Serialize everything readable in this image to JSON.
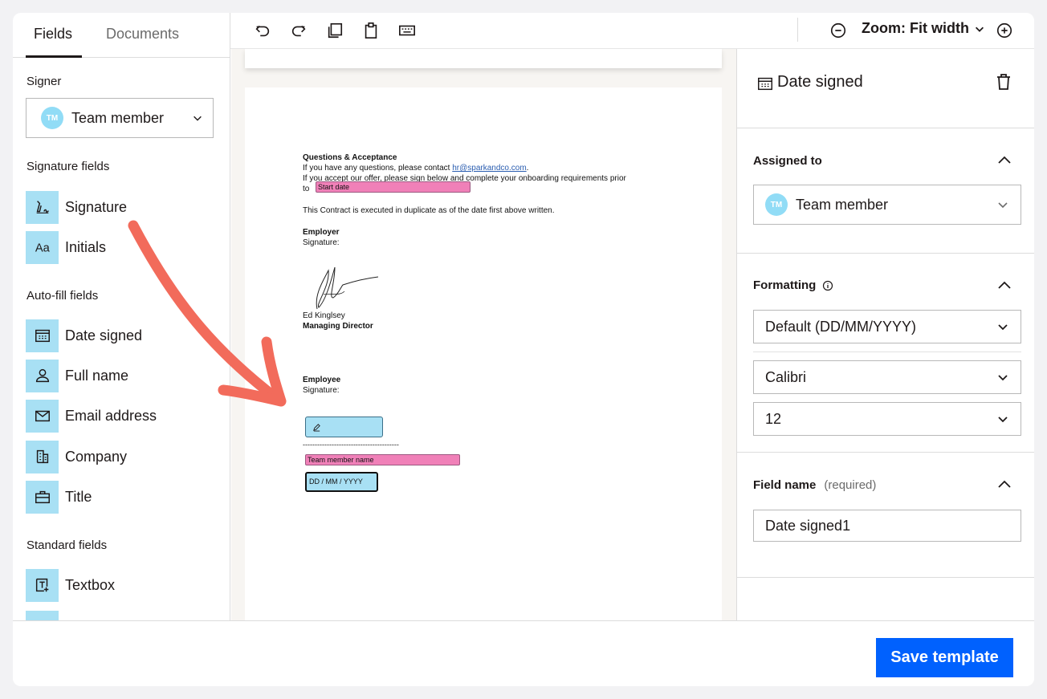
{
  "tabs": {
    "fields": "Fields",
    "documents": "Documents"
  },
  "left": {
    "signer_label": "Signer",
    "signer": {
      "initials": "TM",
      "name": "Team member"
    },
    "signature_fields_label": "Signature fields",
    "signature_fields": [
      {
        "label": "Signature",
        "icon": "signature-icon"
      },
      {
        "label": "Initials",
        "icon": "initials-icon"
      }
    ],
    "autofill_label": "Auto-fill fields",
    "autofill_fields": [
      {
        "label": "Date signed",
        "icon": "calendar-icon"
      },
      {
        "label": "Full name",
        "icon": "person-icon"
      },
      {
        "label": "Email address",
        "icon": "envelope-icon"
      },
      {
        "label": "Company",
        "icon": "building-icon"
      },
      {
        "label": "Title",
        "icon": "briefcase-icon"
      }
    ],
    "standard_label": "Standard fields",
    "standard_fields": [
      {
        "label": "Textbox",
        "icon": "textbox-icon"
      }
    ]
  },
  "toolbar": {
    "zoom_label": "Zoom: Fit width"
  },
  "document": {
    "heading": "Questions & Acceptance",
    "line1_pre": "If you have any questions, please contact ",
    "line1_link": "hr@sparkandco.com",
    "line1_post": ".",
    "line2": "If you accept our offer, please sign below and complete your onboarding requirements prior",
    "line3_pre": "to",
    "start_date_field": "Start date",
    "executed": "This Contract is executed in duplicate as of the date first above written.",
    "employer": "Employer",
    "signature_label": "Signature:",
    "signer_name": "Ed Kinglsey",
    "signer_title": "Managing Director",
    "employee": "Employee",
    "employee_signature_label": "Signature:",
    "dash_line": "----------------------------------------",
    "name_field": "Team member name",
    "date_field": "DD / MM / YYYY"
  },
  "right": {
    "title": "Date signed",
    "assigned_label": "Assigned to",
    "assignee": {
      "initials": "TM",
      "name": "Team member"
    },
    "formatting_label": "Formatting",
    "format_value": "Default (DD/MM/YYYY)",
    "font_value": "Calibri",
    "size_value": "12",
    "field_name_label": "Field name",
    "field_name_required": "(required)",
    "field_name_value": "Date signed1"
  },
  "footer": {
    "save_label": "Save template"
  },
  "colors": {
    "accent": "#0061fe",
    "field_blue": "#a8e0f4",
    "field_pink": "#f080b8",
    "arrow": "#f26b5b"
  }
}
